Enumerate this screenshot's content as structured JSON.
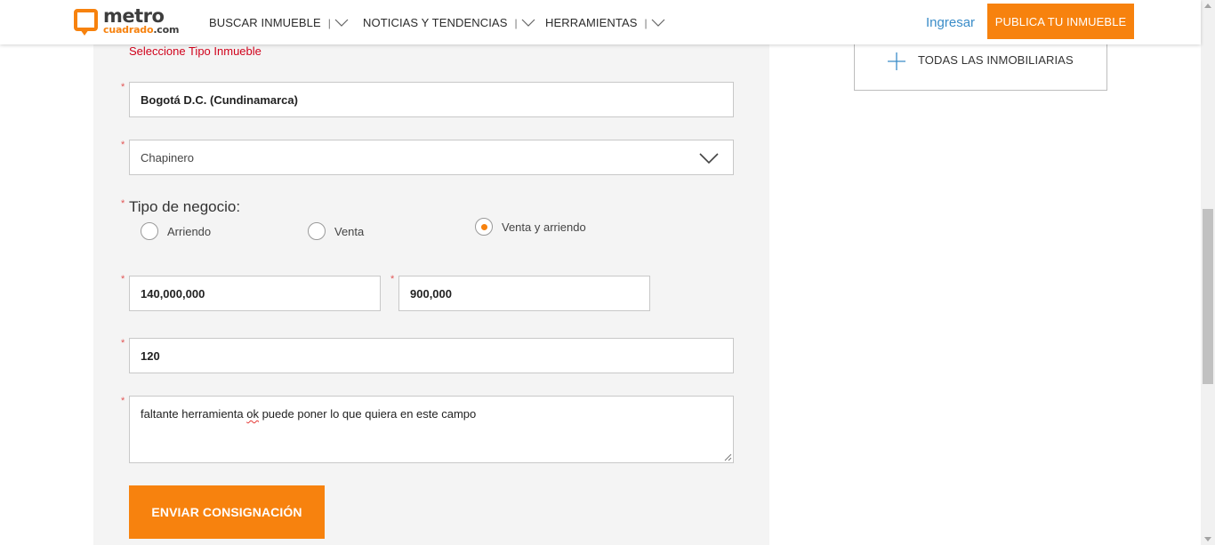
{
  "header": {
    "logo": {
      "line1": "metro",
      "line2": "cuadrado",
      "line2_suffix": ".com"
    },
    "nav": [
      {
        "label": "BUSCAR INMUEBLE"
      },
      {
        "label": "NOTICIAS Y TENDENCIAS"
      },
      {
        "label": "HERRAMIENTAS"
      }
    ],
    "login_label": "Ingresar",
    "publish_label": "PUBLICA TU INMUEBLE"
  },
  "sidebar": {
    "all_agencies_label": "TODAS LAS INMOBILIARIAS"
  },
  "form": {
    "property_type_error": "Seleccione Tipo Inmueble",
    "required_mark": "*",
    "city_value": "Bogotá D.C. (Cundinamarca)",
    "zone_value": "Chapinero",
    "business_type_label": "Tipo de negocio:",
    "business_options": [
      {
        "label": "Arriendo",
        "checked": false
      },
      {
        "label": "Venta",
        "checked": false
      },
      {
        "label": "Venta y arriendo",
        "checked": true
      }
    ],
    "sale_price_value": "140,000,000",
    "rent_price_value": "900,000",
    "area_value": "120",
    "comments_value": {
      "pre": "faltante herramienta ",
      "misspelled": "ok",
      "post": " puede poner lo que quiera en este campo"
    },
    "submit_label": "ENVIAR CONSIGNACIÓN"
  },
  "colors": {
    "brand_orange": "#f7820e",
    "link_blue": "#3a8cc8",
    "error_red": "#d0021b"
  },
  "icons": [
    "logo-mark-icon",
    "chevron-down-icon",
    "plus-icon",
    "resize-grip-icon"
  ]
}
